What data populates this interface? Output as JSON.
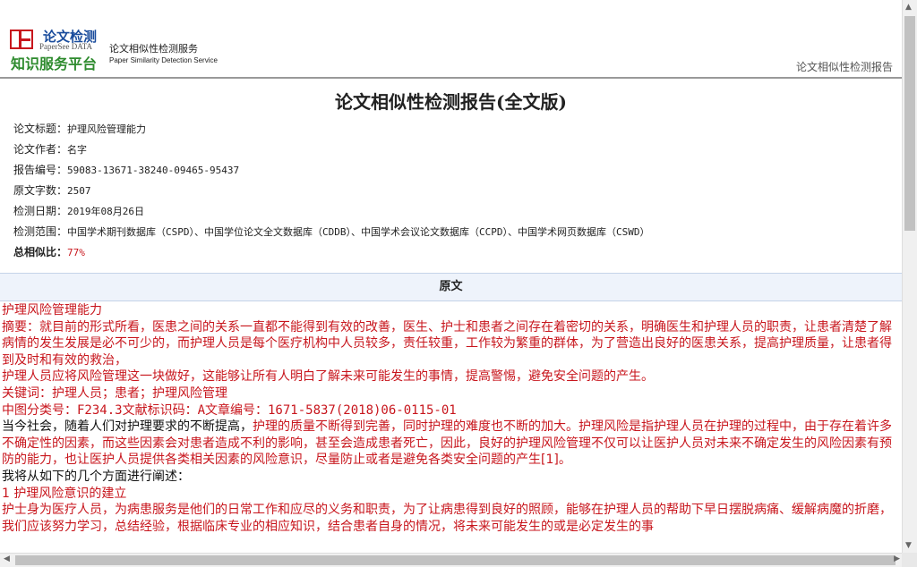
{
  "header": {
    "logo_cn_1": "论文检测",
    "logo_en": "PaperSee DATA",
    "logo_cn_2": "知识服务平台",
    "service_cn": "论文相似性检测服务",
    "service_en": "Paper Similarity Detection Service",
    "right_label": "论文相似性检测报告"
  },
  "report": {
    "title": "论文相似性检测报告(全文版)",
    "meta": [
      {
        "label": "论文标题：",
        "value": "护理风险管理能力"
      },
      {
        "label": "论文作者：",
        "value": "名字"
      },
      {
        "label": "报告编号：",
        "value": "59083-13671-38240-09465-95437"
      },
      {
        "label": "原文字数：",
        "value": "2507"
      },
      {
        "label": "检测日期：",
        "value": "2019年08月26日"
      },
      {
        "label": "检测范围：",
        "value": "中国学术期刊数据库（CSPD）、中国学位论文全文数据库（CDDB）、中国学术会议论文数据库（CCPD）、中国学术网页数据库（CSWD）"
      },
      {
        "label": "总相似比：",
        "value": "77%"
      }
    ],
    "section_header": "原文"
  },
  "content": {
    "p1": "护理风险管理能力",
    "p2": "摘要：就目前的形式所看，医患之间的关系一直都不能得到有效的改善，医生、护士和患者之间存在着密切的关系，明确医生和护理人员的职责，让患者清楚了解病情的发生发展是必不可少的，而护理人员是每个医疗机构中人员较多，责任较重，工作较为繁重的群体，为了营造出良好的医患关系，提高护理质量，让患者得到及时和有效的救治，",
    "p3": "护理人员应将风险管理这一块做好，这能够让所有人明白了解未来可能发生的事情，提高警惕，避免安全问题的产生。",
    "p4": "关键词：护理人员；患者；护理风险管理",
    "p5": "中图分类号：F234.3文献标识码：A文章编号：1671-5837(2018)06-0115-01",
    "p6_black": "当今社会，随着人们对护理要求的不断提高，",
    "p6_red": "护理的质量不断得到完善，同时护理的难度也不断的加大。护理风险是指护理人员在护理的过程中，由于存在着许多不确定性的因素，而这些因素会对患者造成不利的影响，甚至会造成患者死亡，因此，良好的护理风险管理不仅可以让医护人员对未来不确定发生的风险因素有预防的能力，也让医护人员提供各类相关因素的风险意识，尽量防止或者是避免各类安全问题的产生[1]。",
    "p7": "我将从如下的几个方面进行阐述：",
    "p8": "1 护理风险意识的建立",
    "p9": "护士身为医疗人员，为病患服务是他们的日常工作和应尽的义务和职责，为了让病患得到良好的照顾，能够在护理人员的帮助下早日摆脱病痛、缓解病魔的折磨，我们应该努力学习，总结经验，根据临床专业的相应知识，结合患者自身的情况，将未来可能发生的或是必定发生的事"
  },
  "colors": {
    "accent_red": "#c8161d",
    "logo_blue": "#1a4c9c",
    "logo_green": "#2e8b2e"
  }
}
